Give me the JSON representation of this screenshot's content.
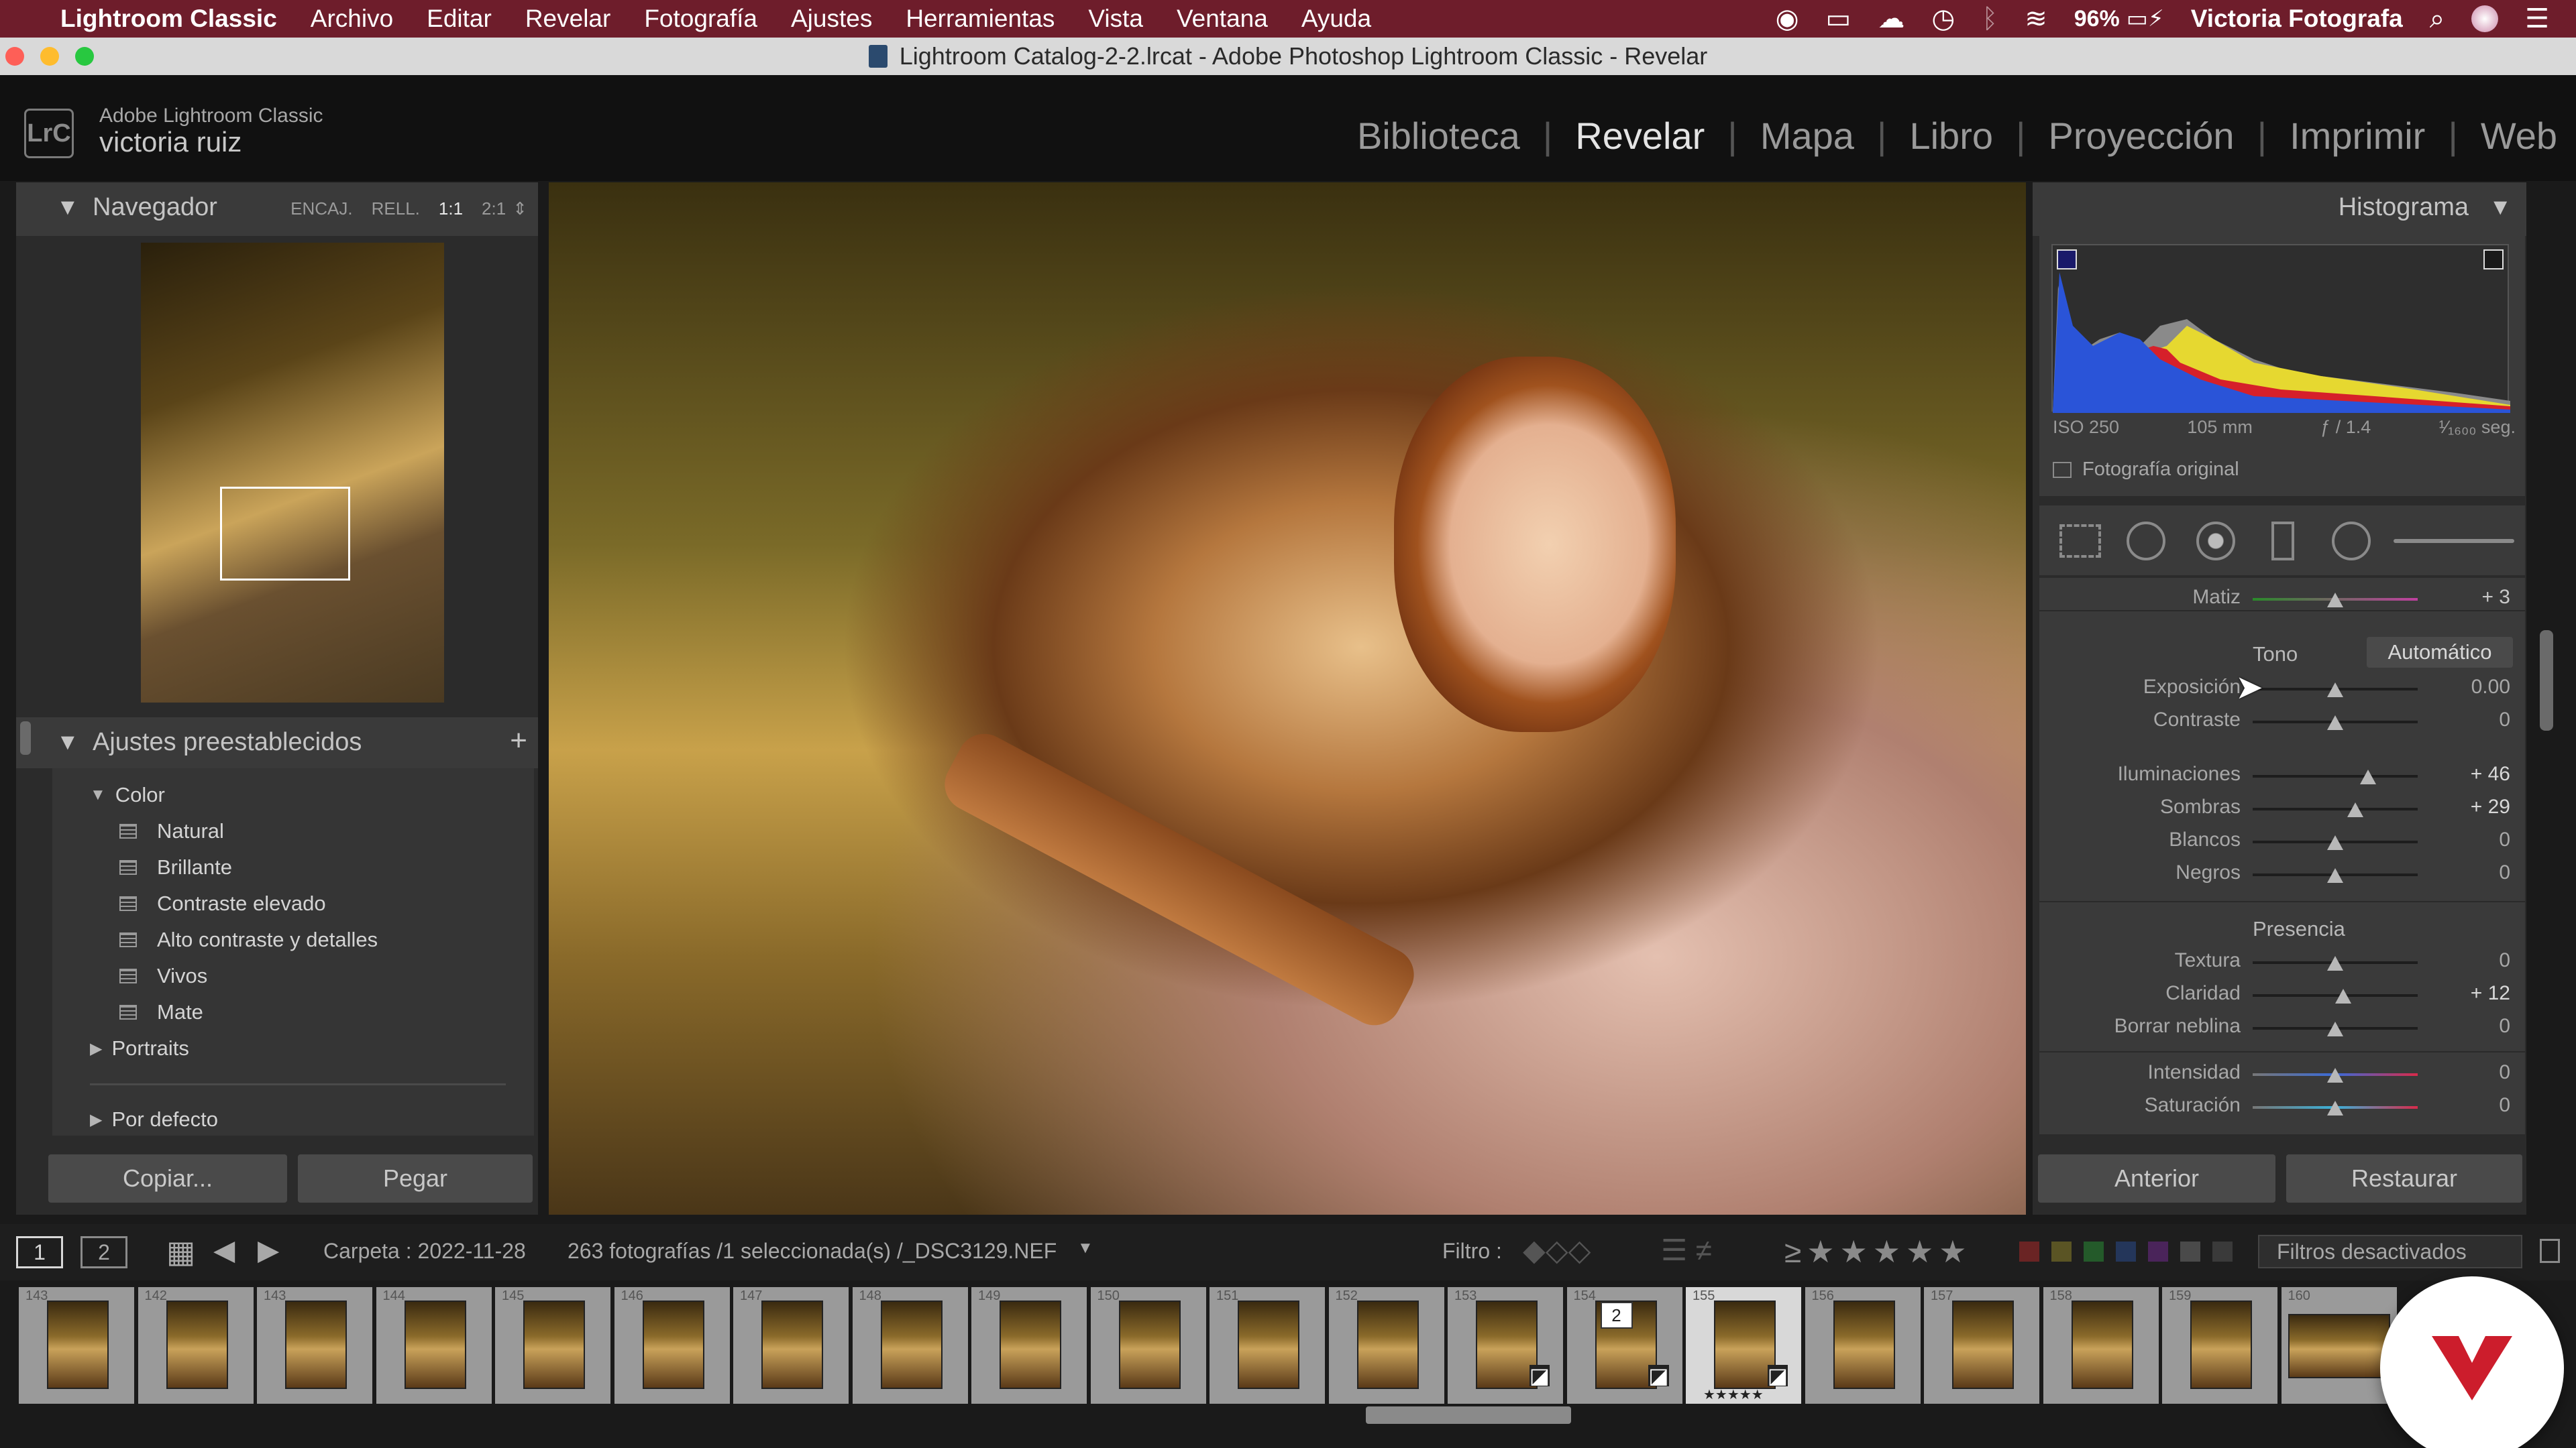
{
  "menubar": {
    "app_name": "Lightroom Classic",
    "items": [
      "Archivo",
      "Editar",
      "Revelar",
      "Fotografía",
      "Ajustes",
      "Herramientas",
      "Vista",
      "Ventana",
      "Ayuda"
    ],
    "battery": "96%",
    "user": "Victoria Fotografa"
  },
  "window": {
    "title": "Lightroom Catalog-2-2.lrcat - Adobe Photoshop Lightroom Classic - Revelar"
  },
  "identity": {
    "badge": "LrC",
    "product": "Adobe Lightroom Classic",
    "user": "victoria ruiz"
  },
  "modules": [
    "Biblioteca",
    "Revelar",
    "Mapa",
    "Libro",
    "Proyección",
    "Imprimir",
    "Web"
  ],
  "active_module": "Revelar",
  "navigator": {
    "title": "Navegador",
    "zoom_options": [
      "ENCAJ.",
      "RELL.",
      "1:1",
      "2:1"
    ],
    "active_zoom": "1:1"
  },
  "presets": {
    "title": "Ajustes preestablecidos",
    "add": "+",
    "groups": [
      {
        "name": "Color",
        "expanded": true,
        "items": [
          "Natural",
          "Brillante",
          "Contraste elevado",
          "Alto contraste y detalles",
          "Vivos",
          "Mate"
        ]
      },
      {
        "name": "Portraits",
        "expanded": false
      },
      {
        "name": "Por defecto",
        "expanded": false
      }
    ]
  },
  "left_buttons": {
    "copy": "Copiar...",
    "paste": "Pegar"
  },
  "histogram": {
    "title": "Histograma",
    "iso": "ISO 250",
    "focal": "105 mm",
    "aperture": "ƒ / 1.4",
    "shutter": "¹⁄₁₆₀₀ seg.",
    "original_photo": "Fotografía original"
  },
  "basic": {
    "hue": {
      "label": "Matiz",
      "value": "+ 3",
      "level": 0.5
    },
    "tone_label": "Tono",
    "auto": "Automático",
    "tone": [
      {
        "label": "Exposición",
        "value": "0.00",
        "level": 0.5
      },
      {
        "label": "Contraste",
        "value": "0",
        "level": 0.5
      }
    ],
    "tone2": [
      {
        "label": "Iluminaciones",
        "value": "+ 46",
        "level": 0.7
      },
      {
        "label": "Sombras",
        "value": "+ 29",
        "level": 0.62
      },
      {
        "label": "Blancos",
        "value": "0",
        "level": 0.5
      },
      {
        "label": "Negros",
        "value": "0",
        "level": 0.5
      }
    ],
    "presence_label": "Presencia",
    "presence": [
      {
        "label": "Textura",
        "value": "0",
        "level": 0.5
      },
      {
        "label": "Claridad",
        "value": "+ 12",
        "level": 0.55
      },
      {
        "label": "Borrar neblina",
        "value": "0",
        "level": 0.5
      }
    ],
    "color": [
      {
        "label": "Intensidad",
        "value": "0",
        "level": 0.5
      },
      {
        "label": "Saturación",
        "value": "0",
        "level": 0.5
      }
    ]
  },
  "right_buttons": {
    "previous": "Anterior",
    "reset": "Restaurar"
  },
  "toolbar": {
    "screen1": "1",
    "screen2": "2",
    "folder": "Carpeta : 2022-11-28",
    "count": "263 fotografías /1 seleccionada(s) /_DSC3129.NEF",
    "filter_label": "Filtro :",
    "filters_off": "Filtros desactivados"
  },
  "filmstrip": {
    "numbers": [
      "143",
      "142",
      "143",
      "144",
      "145",
      "146",
      "147",
      "148",
      "149",
      "150",
      "151",
      "152",
      "153",
      "154",
      "155",
      "156",
      "157",
      "158",
      "159",
      "160"
    ],
    "stack_badge": "2",
    "selected_rating": "★★★★★"
  },
  "colors": {
    "menubar": "#6e1d2b",
    "panel": "#3a3a3a",
    "background": "#1a1a1a",
    "watermark": "#cc1d2c"
  }
}
